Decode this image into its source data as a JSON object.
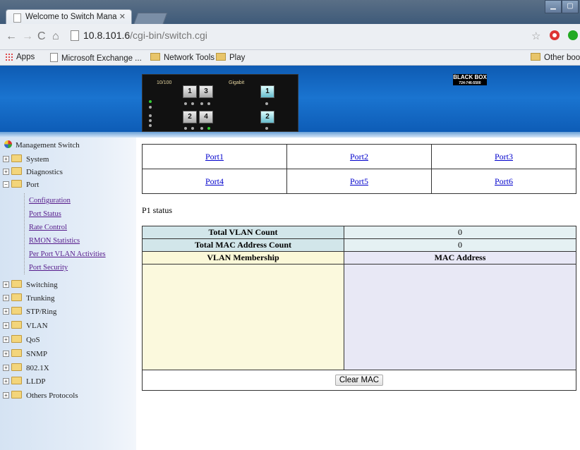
{
  "browser": {
    "tab_title": "Welcome to Switch Mana",
    "url_host": "10.8.101.6",
    "url_path": "/cgi-bin/switch.cgi",
    "bookmarks": [
      "Apps",
      "Microsoft Exchange ...",
      "Network Tools",
      "Play",
      "Other book"
    ]
  },
  "banner": {
    "speed_label": "10/100",
    "gigabit_label": "Gigabit",
    "ports_top": [
      "1",
      "3"
    ],
    "ports_bottom": [
      "2",
      "4"
    ],
    "gig_ports": [
      "1",
      "2"
    ],
    "logo_text": "BLACK BOX",
    "logo_phone": "724-746-5500"
  },
  "sidebar": {
    "root": "Management Switch",
    "items": [
      "System",
      "Diagnostics",
      "Port"
    ],
    "port_subitems": [
      "Configuration",
      "Port Status",
      "Rate Control",
      "RMON Statistics",
      "Per Port VLAN Activities",
      "Port Security"
    ],
    "items_after": [
      "Switching",
      "Trunking",
      "STP/Ring",
      "VLAN",
      "QoS",
      "SNMP",
      "802.1X",
      "LLDP",
      "Others Protocols"
    ]
  },
  "main": {
    "port_links": [
      "Port1",
      "Port2",
      "Port3",
      "Port4",
      "Port5",
      "Port6"
    ],
    "status_title": "P1 status",
    "vlan_count_label": "Total VLAN Count",
    "vlan_count_value": "0",
    "mac_count_label": "Total MAC Address Count",
    "mac_count_value": "0",
    "vlan_membership_label": "VLAN Membership",
    "mac_address_label": "MAC Address",
    "clear_mac_label": "Clear MAC"
  }
}
